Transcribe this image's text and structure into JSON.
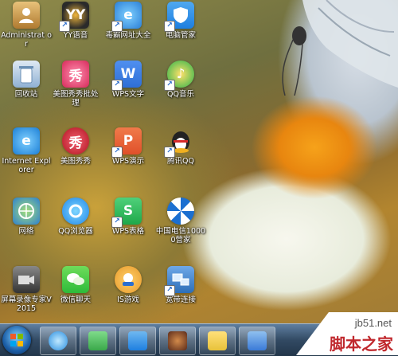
{
  "desktop": {
    "icons": [
      {
        "label": "Administrat or",
        "icon": "user-folder-icon",
        "color": "#c9a25a",
        "shortcut": false
      },
      {
        "label": "YY语音",
        "icon": "yy-voice-icon",
        "color": "#2a2a2a",
        "shortcut": true
      },
      {
        "label": "毒霸网址大全",
        "icon": "ie-browser-icon",
        "color": "#2b7fd6",
        "shortcut": true
      },
      {
        "label": "电脑管家",
        "icon": "pc-manager-icon",
        "color": "#1e7fe0",
        "shortcut": true
      },
      {
        "label": "回收站",
        "icon": "recycle-bin-icon",
        "color": "#8fb1d4",
        "shortcut": false
      },
      {
        "label": "美图秀秀批处理",
        "icon": "meitu-batch-icon",
        "color": "#e04a7a",
        "shortcut": false
      },
      {
        "label": "WPS文字",
        "icon": "wps-writer-icon",
        "color": "#2f6fd6",
        "shortcut": true
      },
      {
        "label": "QQ音乐",
        "icon": "qq-music-icon",
        "color": "#28b34a",
        "shortcut": true
      },
      {
        "label": "Internet Explorer",
        "icon": "ie-browser-icon",
        "color": "#2b8fe0",
        "shortcut": false
      },
      {
        "label": "美图秀秀",
        "icon": "meitu-icon",
        "color": "#d62a3a",
        "shortcut": false
      },
      {
        "label": "WPS演示",
        "icon": "wps-presentation-icon",
        "color": "#e0502a",
        "shortcut": true
      },
      {
        "label": "腾讯QQ",
        "icon": "qq-penguin-icon",
        "color": "#222222",
        "shortcut": true
      },
      {
        "label": "网络",
        "icon": "network-icon",
        "color": "#3a8ad8",
        "shortcut": false
      },
      {
        "label": "QQ浏览器",
        "icon": "qq-browser-icon",
        "color": "#1f86e8",
        "shortcut": false
      },
      {
        "label": "WPS表格",
        "icon": "wps-spreadsheet-icon",
        "color": "#1fa84a",
        "shortcut": true
      },
      {
        "label": "中国电信10000营家",
        "icon": "china-telecom-icon",
        "color": "#1b6fd0",
        "shortcut": false
      },
      {
        "label": "屏幕录像专家V2015",
        "icon": "screen-recorder-icon",
        "color": "#555555",
        "shortcut": false
      },
      {
        "label": "微信聊天",
        "icon": "wechat-icon",
        "color": "#2dbb3a",
        "shortcut": false
      },
      {
        "label": "IS游戏",
        "icon": "is-game-icon",
        "color": "#e89a2a",
        "shortcut": false
      },
      {
        "label": "宽带连接",
        "icon": "broadband-connection-icon",
        "color": "#2d6fb8",
        "shortcut": true
      }
    ]
  },
  "taskbar": {
    "items": [
      {
        "icon": "qq-browser-icon",
        "color": "#2b8fe0"
      },
      {
        "icon": "recycle-icon",
        "color": "#3aa84a"
      },
      {
        "icon": "pc-manager-icon",
        "color": "#1e7fe0"
      },
      {
        "icon": "game-icon",
        "color": "#8a4a2a"
      },
      {
        "icon": "notes-icon",
        "color": "#e8c23a"
      },
      {
        "icon": "control-panel-icon",
        "color": "#3a7ad8"
      }
    ]
  },
  "watermark": {
    "domain": "jb51.net",
    "name": "脚本之家"
  }
}
